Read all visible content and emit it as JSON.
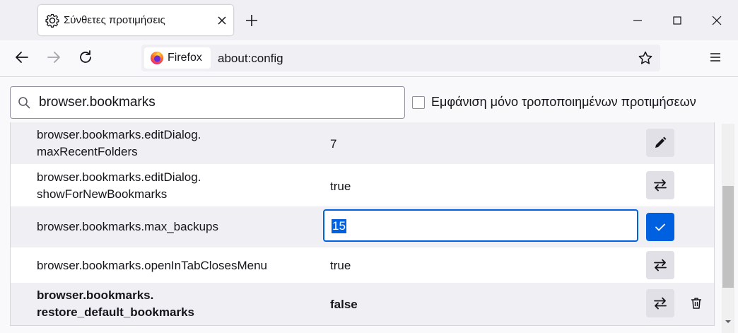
{
  "tab": {
    "title": "Σύνθετες προτιμήσεις",
    "icon": "gear-icon"
  },
  "window_controls": [
    "minimize-icon",
    "maximize-icon",
    "close-icon"
  ],
  "navbar": {
    "identity_label": "Firefox",
    "url": "about:config",
    "icons": [
      "back-icon",
      "forward-icon",
      "reload-icon",
      "firefox-logo-icon",
      "bookmark-star-icon",
      "hamburger-menu-icon"
    ]
  },
  "search": {
    "value": "browser.bookmarks",
    "icon": "search-icon"
  },
  "modified_only": {
    "label": "Εμφάνιση μόνο τροποποιημένων προτιμήσεων",
    "checked": false
  },
  "prefs": [
    {
      "name_line1": "browser.bookmarks.editDialog.",
      "name_line2": "maxRecentFolders",
      "value": "7",
      "action": "edit-icon",
      "modified": false
    },
    {
      "name_line1": "browser.bookmarks.editDialog.",
      "name_line2": "showForNewBookmarks",
      "value": "true",
      "action": "toggle-icon",
      "modified": false
    },
    {
      "name": "browser.bookmarks.max_backups",
      "editing_value": "15",
      "action": "save-check-icon",
      "modified": false
    },
    {
      "name": "browser.bookmarks.openInTabClosesMenu",
      "value": "true",
      "action": "toggle-icon",
      "modified": false
    },
    {
      "name_line1": "browser.bookmarks.",
      "name_line2": "restore_default_bookmarks",
      "value": "false",
      "action": "toggle-icon",
      "modified": true,
      "extra_action": "trash-icon"
    }
  ],
  "colors": {
    "accent": "#0061e0",
    "row_alt": "#f0f0f4",
    "button_bg": "#e0e0e6"
  }
}
